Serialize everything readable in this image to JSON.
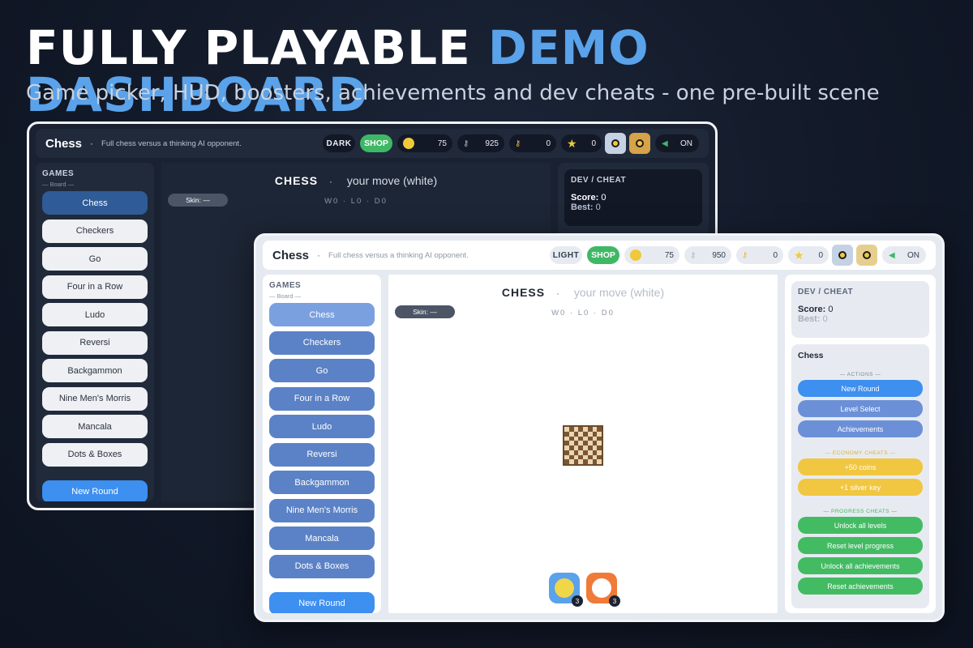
{
  "headline": {
    "part1": "FULLY PLAYABLE",
    "part2": "DEMO DASHBOARD"
  },
  "subline": "Game picker, HUD, boosters, achievements and dev cheats - one pre-built scene",
  "dark": {
    "title": "Chess",
    "sep": "·",
    "desc": "Full chess versus a thinking AI opponent.",
    "mode": "DARK",
    "shop": "SHOP",
    "coins": "75",
    "silver_keys": "925",
    "gold_keys": "0",
    "stars": "0",
    "sound": "ON",
    "games_label": "GAMES",
    "category": "— Board —",
    "games": [
      "Chess",
      "Checkers",
      "Go",
      "Four in a Row",
      "Ludo",
      "Reversi",
      "Backgammon",
      "Nine Men's Morris",
      "Mancala",
      "Dots & Boxes"
    ],
    "new_round": "New Round",
    "stage_name": "CHESS",
    "stage_status": "your move (white)",
    "skin": "Skin: —",
    "record": "W0 · L0 · D0",
    "cheat_title": "DEV / CHEAT",
    "score_label": "Score:",
    "score": "0",
    "best_label": "Best:",
    "best": "0"
  },
  "light": {
    "title": "Chess",
    "sep": "·",
    "desc": "Full chess versus a thinking AI opponent.",
    "mode": "LIGHT",
    "shop": "SHOP",
    "coins": "75",
    "silver_keys": "950",
    "gold_keys": "0",
    "stars": "0",
    "sound": "ON",
    "games_label": "GAMES",
    "category": "— Board —",
    "games": [
      "Chess",
      "Checkers",
      "Go",
      "Four in a Row",
      "Ludo",
      "Reversi",
      "Backgammon",
      "Nine Men's Morris",
      "Mancala",
      "Dots & Boxes"
    ],
    "new_round": "New Round",
    "stage_name": "CHESS",
    "stage_status": "your move (white)",
    "skin": "Skin: —",
    "record": "W0 · L0 · D0",
    "booster_1_count": "3",
    "booster_2_count": "3",
    "cheat_title": "DEV / CHEAT",
    "score_label": "Score:",
    "score": "0",
    "best_label": "Best:",
    "best": "0",
    "actions_title": "Chess",
    "actions_section": "— ACTIONS —",
    "actions": [
      "New Round",
      "Level Select",
      "Achievements"
    ],
    "economy_section": "— ECONOMY CHEATS —",
    "economy": [
      "+50 coins",
      "+1 silver key"
    ],
    "progress_section": "— PROGRESS CHEATS —",
    "progress": [
      "Unlock all levels",
      "Reset level progress",
      "Unlock all achievements",
      "Reset achievements"
    ]
  },
  "colors": {
    "accent": "#5aa2ea",
    "shop": "#3fb866",
    "coin": "#f0c93a",
    "primary_button": "#3d8ff0"
  },
  "icons": {
    "coin": "coin-icon",
    "silver_key": "silver-key-icon",
    "gold_key": "gold-key-icon",
    "star": "star-icon",
    "speaker": "speaker-icon"
  }
}
